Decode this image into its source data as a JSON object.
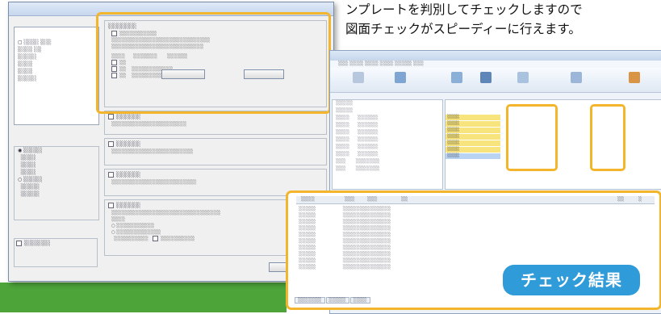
{
  "caption": {
    "line1": "ンプレートを判別してチェックしますので",
    "line2": "図面チェックがスピーディーに行えます。"
  },
  "result_badge": "チェック結果",
  "colors": {
    "highlight": "#f2b52b",
    "badge": "#2f9bd8",
    "green_bar": "#4da53a"
  }
}
